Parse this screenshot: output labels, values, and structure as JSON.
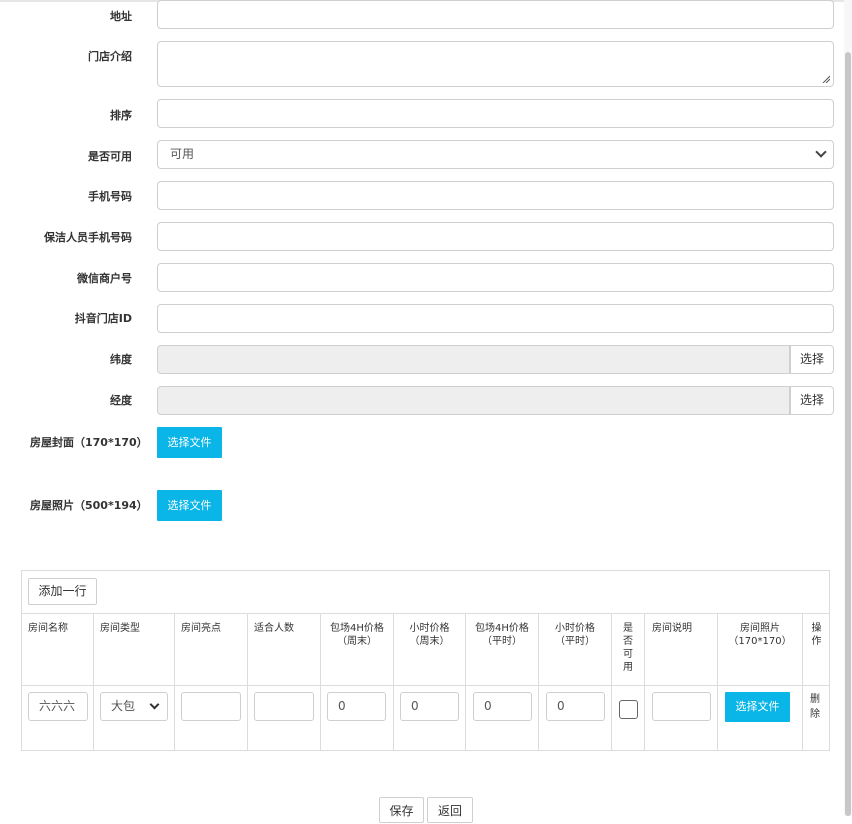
{
  "form": {
    "address": {
      "label": "地址",
      "value": ""
    },
    "intro": {
      "label": "门店介绍",
      "value": ""
    },
    "sort": {
      "label": "排序",
      "value": ""
    },
    "available": {
      "label": "是否可用",
      "selected": "可用"
    },
    "phone": {
      "label": "手机号码",
      "value": ""
    },
    "cleaner_phone": {
      "label": "保洁人员手机号码",
      "value": ""
    },
    "wechat_merchant": {
      "label": "微信商户号",
      "value": ""
    },
    "douyin_id": {
      "label": "抖音门店ID",
      "value": ""
    },
    "latitude": {
      "label": "纬度",
      "value": "",
      "button": "选择"
    },
    "longitude": {
      "label": "经度",
      "value": "",
      "button": "选择"
    },
    "cover": {
      "label": "房屋封面（170*170）",
      "button": "选择文件"
    },
    "photos": {
      "label": "房屋照片（500*194）",
      "button": "选择文件"
    }
  },
  "room_table": {
    "add_row_button": "添加一行",
    "columns": [
      "房间名称",
      "房间类型",
      "房间亮点",
      "适合人数",
      "包场4H价格\n（周末）",
      "小时价格\n（周末）",
      "包场4H价格\n（平时）",
      "小时价格\n（平时）",
      "是\n否\n可\n用",
      "房间说明",
      "房间照片\n（170*170）",
      "操\n作"
    ],
    "rows": [
      {
        "name": "六六六",
        "type": "大包",
        "highlight": "",
        "capacity": "",
        "weekend_4h": "0",
        "weekend_hourly": "0",
        "weekday_4h": "0",
        "weekday_hourly": "0",
        "available": false,
        "description": "",
        "photo_button": "选择文件",
        "delete": "删\n除"
      }
    ]
  },
  "actions": {
    "save": "保存",
    "back": "返回"
  },
  "colors": {
    "primary": "#0ab5e8",
    "border": "#cfcfcf",
    "disabled_bg": "#eeeeee"
  }
}
